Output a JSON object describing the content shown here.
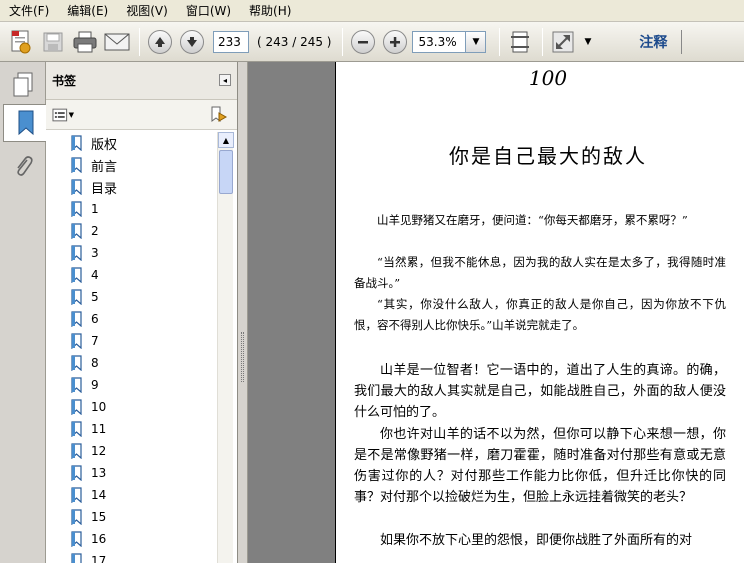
{
  "menubar": {
    "items": [
      "文件(F)",
      "编辑(E)",
      "视图(V)",
      "窗口(W)",
      "帮助(H)"
    ]
  },
  "toolbar": {
    "current_page": "233",
    "page_count": "( 243 / 245 )",
    "zoom": "53.3%",
    "annotate_label": "注释"
  },
  "panel": {
    "title": "书签"
  },
  "bookmarks": [
    "版权",
    "前言",
    "目录",
    "1",
    "2",
    "3",
    "4",
    "5",
    "6",
    "7",
    "8",
    "9",
    "10",
    "11",
    "12",
    "13",
    "14",
    "15",
    "16",
    "17"
  ],
  "document": {
    "page_number": "100",
    "title": "你是自己最大的敌人",
    "paragraphs": [
      "山羊见野猪又在磨牙，便问道：“你每天都磨牙，累不累呀？”",
      "“当然累，但我不能休息，因为我的敌人实在是太多了，我得随时准备战斗。”",
      "“其实，你没什么敌人，你真正的敌人是你自己，因为你放不下仇恨，容不得别人比你快乐。”山羊说完就走了。",
      "山羊是一位智者！它一语中的，道出了人生的真谛。的确，我们最大的敌人其实就是自己，如能战胜自己，外面的敌人便没什么可怕的了。",
      "你也许对山羊的话不以为然，但你可以静下心来想一想，你是不是常像野猪一样，磨刀霍霍，随时准备对付那些有意或无意伤害过你的人？对付那些工作能力比你低，但升迁比你快的同事？对付那个以捡破烂为生，但脸上永远挂着微笑的老头？",
      "如果你不放下心里的怨恨，即便你战胜了外面所有的对"
    ]
  },
  "colors": {
    "toolbar_bg": "#e8e6dd",
    "panel_bg": "#ffffff",
    "doc_bg": "#808080",
    "annotate_text": "#1c4a8c"
  }
}
